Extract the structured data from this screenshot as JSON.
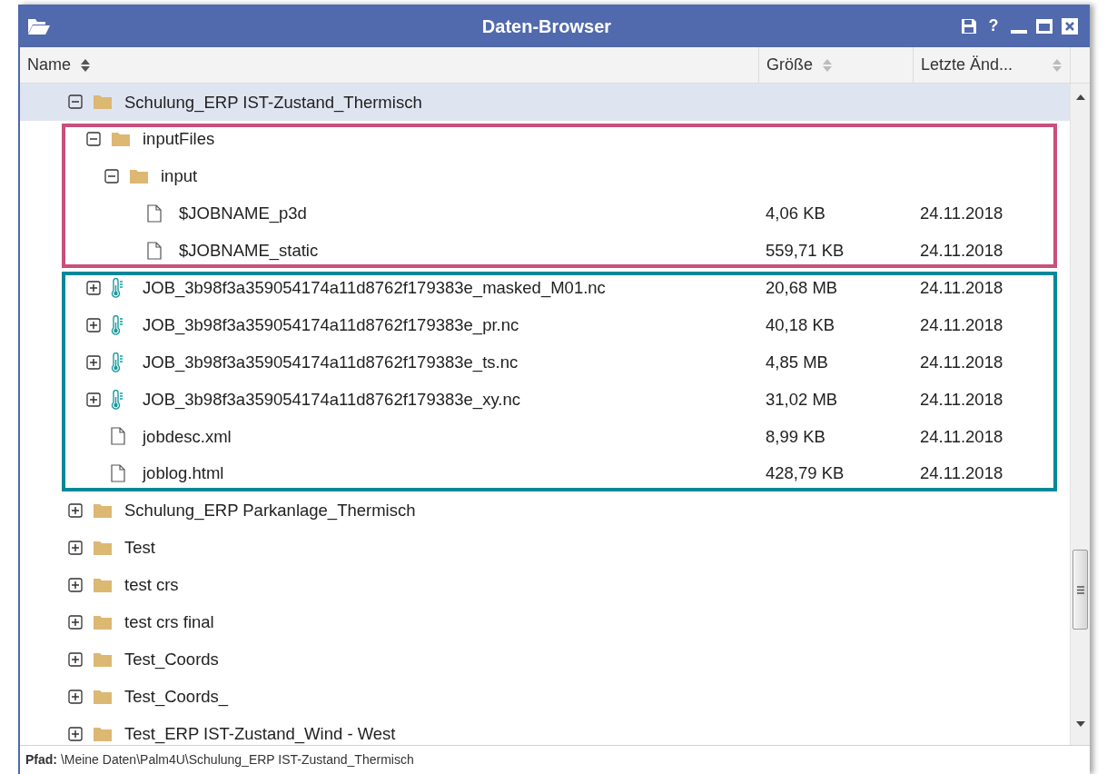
{
  "window": {
    "title": "Daten-Browser",
    "help_label": "?"
  },
  "columns": [
    {
      "label": "Name",
      "sort_active": true
    },
    {
      "label": "Größe",
      "sort_active": false
    },
    {
      "label": "Letzte Änd...",
      "sort_active": false
    }
  ],
  "tree": [
    {
      "name": "Schulung_ERP IST-Zustand_Thermisch",
      "kind": "folder",
      "expanded": true,
      "selected": true,
      "children": [
        {
          "name": "inputFiles",
          "kind": "folder",
          "expanded": true,
          "selected": false,
          "color": "#c94f7c",
          "children": [
            {
              "name": "input",
              "kind": "folder",
              "expanded": true,
              "selected": false,
              "children": [
                {
                  "name": "$JOBNAME_p3d",
                  "kind": "file",
                  "selected": false,
                  "size": "4,06 KB",
                  "modified": "24.11.2018"
                },
                {
                  "name": "$JOBNAME_static",
                  "kind": "file",
                  "selected": false,
                  "size": "559,71 KB",
                  "modified": "24.11.2018"
                }
              ]
            }
          ]
        },
        {
          "name": "JOB_3b98f3a359054174a11d8762f179383e_masked_M01.nc",
          "kind": "dataset",
          "expanded": false,
          "selected": false,
          "color": "#00899a",
          "size": "20,68 MB",
          "modified": "24.11.2018"
        },
        {
          "name": "JOB_3b98f3a359054174a11d8762f179383e_pr.nc",
          "kind": "dataset",
          "expanded": false,
          "selected": false,
          "color": "#00899a",
          "size": "40,18 KB",
          "modified": "24.11.2018"
        },
        {
          "name": "JOB_3b98f3a359054174a11d8762f179383e_ts.nc",
          "kind": "dataset",
          "expanded": false,
          "selected": false,
          "color": "#00899a",
          "size": "4,85 MB",
          "modified": "24.11.2018"
        },
        {
          "name": "JOB_3b98f3a359054174a11d8762f179383e_xy.nc",
          "kind": "dataset",
          "expanded": false,
          "selected": false,
          "color": "#00899a",
          "size": "31,02 MB",
          "modified": "24.11.2018"
        },
        {
          "name": "jobdesc.xml",
          "kind": "file",
          "selected": false,
          "color": "#00899a",
          "size": "8,99 KB",
          "modified": "24.11.2018"
        },
        {
          "name": "joblog.html",
          "kind": "file",
          "selected": false,
          "color": "#00899a",
          "size": "428,79 KB",
          "modified": "24.11.2018"
        }
      ]
    },
    {
      "name": "Schulung_ERP Parkanlage_Thermisch",
      "kind": "folder",
      "expanded": false,
      "selected": false
    },
    {
      "name": "Test",
      "kind": "folder",
      "expanded": false,
      "selected": false
    },
    {
      "name": "test crs",
      "kind": "folder",
      "expanded": false,
      "selected": false
    },
    {
      "name": "test crs final",
      "kind": "folder",
      "expanded": false,
      "selected": false
    },
    {
      "name": "Test_Coords",
      "kind": "folder",
      "expanded": false,
      "selected": false
    },
    {
      "name": "Test_Coords_",
      "kind": "folder",
      "expanded": false,
      "selected": false
    },
    {
      "name": "Test_ERP IST-Zustand_Wind - West",
      "kind": "folder",
      "expanded": false,
      "selected": false
    }
  ],
  "status_bar": {
    "path": "**Pfad:** \\Meine Daten\\Palm4U\\Schulung_ERP IST-Zustand_Thermisch"
  }
}
